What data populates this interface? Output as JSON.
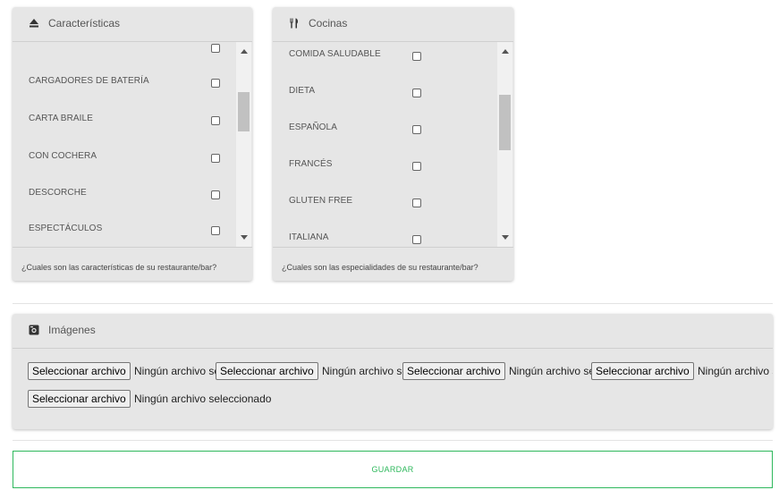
{
  "caracteristicas": {
    "title": "Características",
    "items": [
      {
        "label": "CARGADORES DE BATERÍA"
      },
      {
        "label": "CARTA BRAILE"
      },
      {
        "label": "CON COCHERA"
      },
      {
        "label": "DESCORCHE"
      },
      {
        "label": "ESPECTÁCULOS"
      }
    ],
    "footer": "¿Cuales son las características de su restaurante/bar?"
  },
  "cocinas": {
    "title": "Cocinas",
    "items": [
      {
        "label": "COMIDA SALUDABLE"
      },
      {
        "label": "DIETA"
      },
      {
        "label": "ESPAÑOLA"
      },
      {
        "label": "FRANCÉS"
      },
      {
        "label": "GLUTEN FREE"
      },
      {
        "label": "ITALIANA"
      }
    ],
    "footer": "¿Cuales son las especialidades de su restaurante/bar?"
  },
  "imagenes": {
    "title": "Imágenes",
    "button_label": "Seleccionar archivo",
    "no_file_text": "Ningún archivo seleccionado"
  },
  "save_label": "GUARDAR",
  "colors": {
    "accent": "#2eb85c",
    "panel_bg": "#e6e6e6"
  },
  "icons": {
    "caracteristicas": "eject-icon",
    "cocinas": "utensils-icon",
    "imagenes": "image-icon"
  }
}
